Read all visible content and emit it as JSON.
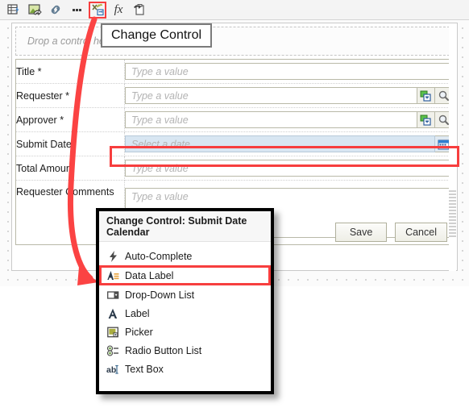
{
  "toolbar": {
    "buttons": [
      {
        "name": "insert-table-icon",
        "title": "Insert Table"
      },
      {
        "name": "insert-image-icon",
        "title": "Insert Image"
      },
      {
        "name": "hyperlink-icon",
        "title": "Hyperlink"
      },
      {
        "name": "more-options-icon",
        "title": "More"
      },
      {
        "name": "change-control-icon",
        "title": "Change Control",
        "selected": true
      },
      {
        "name": "formula-icon",
        "title": "fx"
      },
      {
        "name": "paste-icon",
        "title": "Paste"
      }
    ],
    "formula_label": "fx"
  },
  "tooltip": {
    "text": "Change Control"
  },
  "canvas": {
    "dropzone_text": "Drop a control here"
  },
  "form": {
    "rows": [
      {
        "label": "Title *",
        "placeholder": "Type a value",
        "type": "text",
        "picker": false,
        "lookup": false
      },
      {
        "label": "Requester *",
        "placeholder": "Type a value",
        "type": "text",
        "picker": true,
        "lookup": true
      },
      {
        "label": "Approver *",
        "placeholder": "Type a value",
        "type": "text",
        "picker": true,
        "lookup": true
      },
      {
        "label": "Submit Date",
        "placeholder": "Select a date",
        "type": "date",
        "picker": false,
        "lookup": false,
        "highlighted": true
      },
      {
        "label": "Total Amount",
        "placeholder": "Type a value",
        "type": "text",
        "picker": false,
        "lookup": false
      },
      {
        "label": "Requester Comments",
        "placeholder": "Type a value",
        "type": "textarea",
        "picker": false,
        "lookup": false
      }
    ],
    "save_label": "Save",
    "cancel_label": "Cancel"
  },
  "context_menu": {
    "header": "Change Control: Submit Date Calendar",
    "items": [
      {
        "label": "Auto-Complete",
        "icon": "lightning-bolt-icon",
        "selected": false
      },
      {
        "label": "Data Label",
        "icon": "data-label-icon",
        "selected": true
      },
      {
        "label": "Drop-Down List",
        "icon": "drop-down-list-icon",
        "selected": false
      },
      {
        "label": "Label",
        "icon": "label-icon",
        "selected": false
      },
      {
        "label": "Picker",
        "icon": "picker-icon",
        "selected": false
      },
      {
        "label": "Radio Button List",
        "icon": "radio-button-list-icon",
        "selected": false
      },
      {
        "label": "Text Box",
        "icon": "text-box-icon",
        "selected": false
      }
    ]
  },
  "colors": {
    "highlight_red": "#f73e3e",
    "arrow_red": "#fb4343",
    "date_field_bg": "#d8e6f2"
  }
}
